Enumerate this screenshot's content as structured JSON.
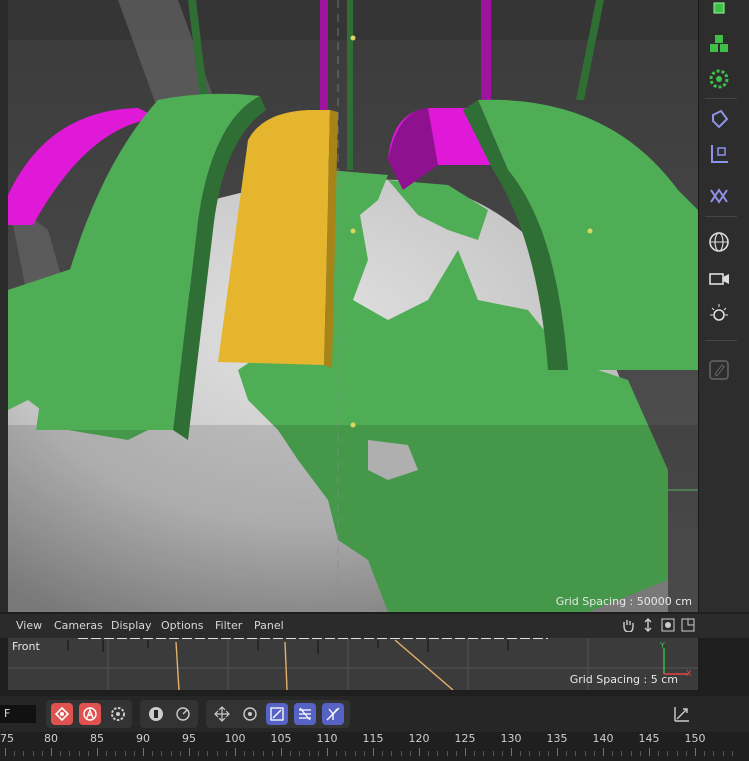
{
  "viewport": {
    "grid_label": "Grid Spacing : 50000 cm"
  },
  "right_toolbar": {
    "icons": [
      "cube-add-icon",
      "cube-cluster-icon",
      "gear-green-icon",
      "cylinder-icon",
      "axis-cube-icon",
      "bend-icon",
      "globe-st-icon",
      "camera-st-icon",
      "light-st-icon",
      "pen-disabled-icon"
    ]
  },
  "menubar": {
    "items": [
      "View",
      "Cameras",
      "Display",
      "Options",
      "Filter",
      "Panel"
    ]
  },
  "front_view": {
    "camera_label": "Front",
    "grid_label": "Grid Spacing : 5 cm"
  },
  "bottom_toolbar": {
    "frame_value": "F"
  },
  "timeline": {
    "tick_labels": [
      "75",
      "80",
      "85",
      "90",
      "95",
      "100",
      "105",
      "110",
      "115",
      "120",
      "125",
      "130",
      "135",
      "140",
      "145",
      "150"
    ]
  },
  "colors": {
    "green": "#4fae55",
    "green_dark": "#2f6e34",
    "yellow": "#e5b52e",
    "magenta": "#e019d8",
    "globe": "#c8c8c8",
    "accent_red": "#e0524f",
    "accent_blue": "#5763c4"
  }
}
